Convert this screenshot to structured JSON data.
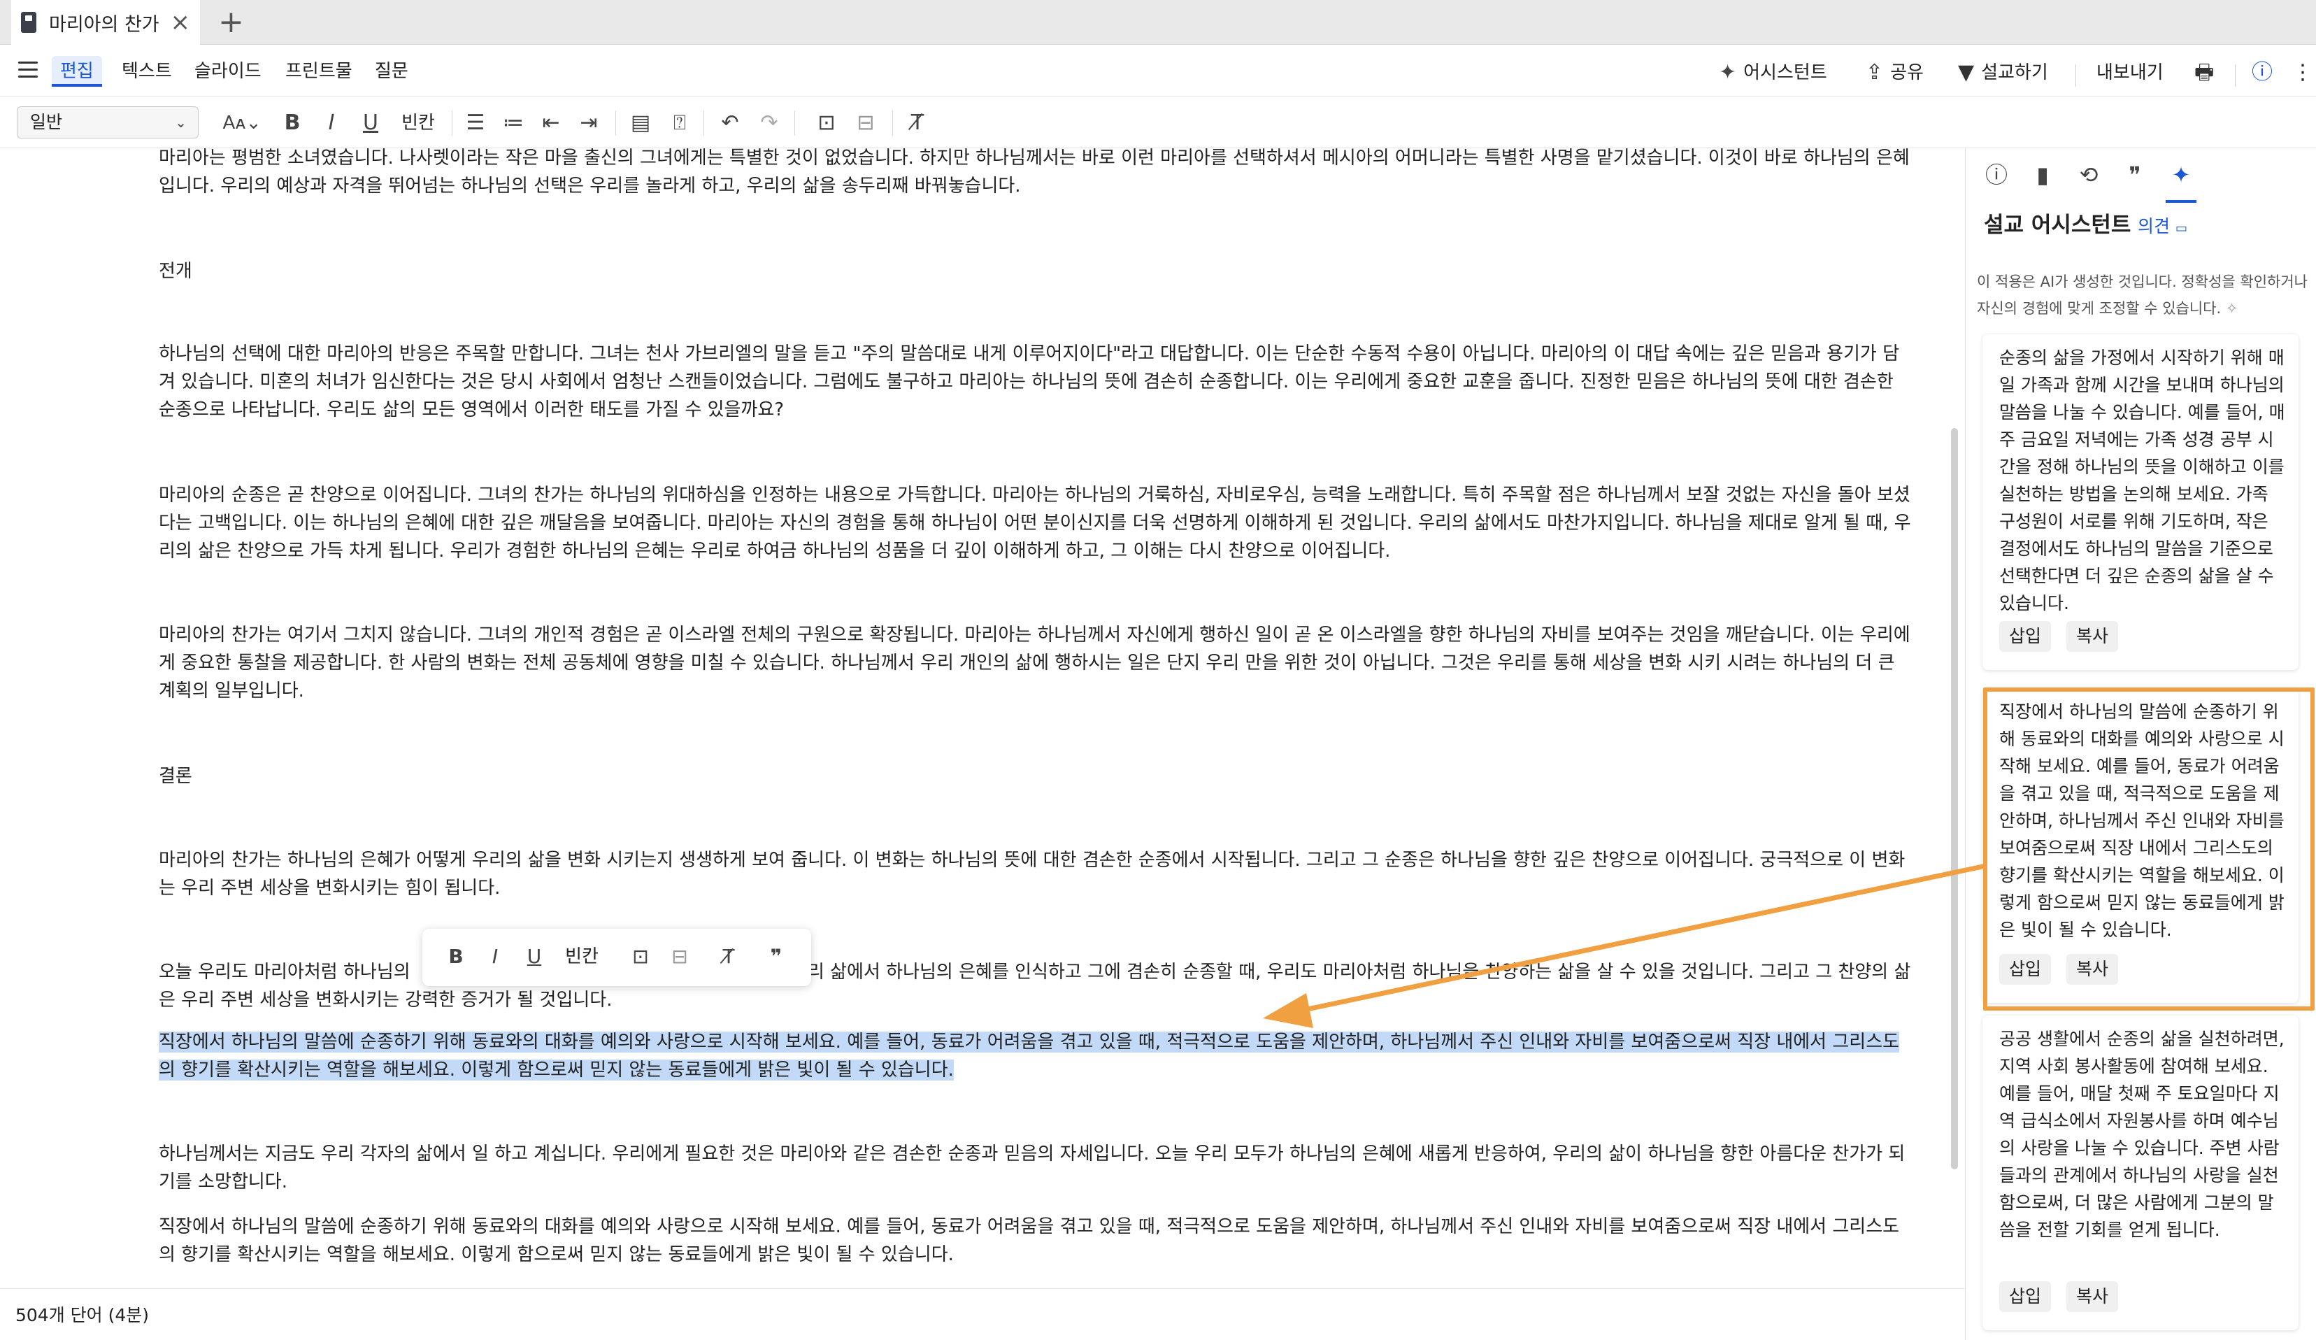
{
  "tab": {
    "title": "마리아의 찬가",
    "close": "×",
    "new": "+"
  },
  "menu": {
    "edit": "편집",
    "text": "텍스트",
    "slide": "슬라이드",
    "print": "프린트물",
    "question": "질문"
  },
  "actions": {
    "assistant": "어시스턴트",
    "share": "공유",
    "sermon": "설교하기",
    "export": "내보내기"
  },
  "toolbar": {
    "style": "일반",
    "bold": "B",
    "italic": "I",
    "underline": "U",
    "blank": "빈칸"
  },
  "document": {
    "p1": "마리아는 평범한 소녀였습니다. 나사렛이라는 작은 마을 출신의 그녀에게는 특별한 것이 없었습니다. 하지만 하나님께서는 바로 이런 마리아를 선택하셔서 메시아의 어머니라는 특별한 사명을 맡기셨습니다. 이것이 바로 하나님의 은혜입니다. 우리의 예상과 자격을 뛰어넘는 하나님의 선택은 우리를 놀라게 하고, 우리의 삶을 송두리째 바꿔놓습니다.",
    "h_development": "전개",
    "p2": "하나님의 선택에 대한 마리아의 반응은 주목할 만합니다. 그녀는 천사 가브리엘의 말을 듣고 \"주의 말씀대로 내게 이루어지이다\"라고 대답합니다. 이는 단순한 수동적 수용이 아닙니다. 마리아의 이 대답 속에는 깊은 믿음과 용기가 담겨 있습니다. 미혼의 처녀가 임신한다는 것은 당시 사회에서 엄청난 스캔들이었습니다. 그럼에도 불구하고 마리아는 하나님의 뜻에 겸손히 순종합니다. 이는 우리에게 중요한 교훈을 줍니다. 진정한 믿음은 하나님의 뜻에 대한 겸손한 순종으로 나타납니다. 우리도 삶의 모든 영역에서 이러한 태도를 가질 수 있을까요?",
    "p3": "마리아의 순종은 곧 찬양으로 이어집니다. 그녀의 찬가는 하나님의 위대하심을 인정하는 내용으로 가득합니다. 마리아는 하나님의 거룩하심, 자비로우심, 능력을 노래합니다. 특히 주목할 점은 하나님께서 보잘 것없는 자신을 돌아 보셨다는 고백입니다. 이는 하나님의 은혜에 대한 깊은 깨달음을 보여줍니다. 마리아는 자신의 경험을 통해 하나님이 어떤 분이신지를 더욱 선명하게 이해하게 된 것입니다. 우리의 삶에서도 마찬가지입니다. 하나님을 제대로 알게 될 때, 우리의 삶은 찬양으로 가득 차게 됩니다. 우리가 경험한 하나님의 은혜는 우리로 하여금 하나님의 성품을 더 깊이 이해하게 하고, 그 이해는 다시 찬양으로 이어집니다.",
    "p4": "마리아의 찬가는 여기서 그치지 않습니다. 그녀의 개인적 경험은 곧 이스라엘 전체의 구원으로 확장됩니다. 마리아는 하나님께서 자신에게 행하신 일이 곧 온 이스라엘을 향한 하나님의 자비를 보여주는 것임을 깨닫습니다. 이는 우리에게 중요한 통찰을 제공합니다. 한 사람의 변화는 전체 공동체에 영향을 미칠 수 있습니다. 하나님께서 우리 개인의 삶에 행하시는 일은 단지 우리 만을 위한 것이 아닙니다. 그것은 우리를 통해 세상을 변화 시키 시려는 하나님의 더 큰 계획의 일부입니다.",
    "h_conclusion": "결론",
    "p5": "마리아의 찬가는 하나님의 은혜가 어떻게 우리의 삶을 변화 시키는지 생생하게 보여 줍니다. 이 변화는 하나님의 뜻에 대한 겸손한 순종에서 시작됩니다. 그리고 그 순종은 하나님을 향한 깊은 찬양으로 이어집니다. 궁극적으로 이 변화는 우리 주변 세상을 변화시키는 힘이 됩니다.",
    "p6_start": "오늘 우리도 마리아처럼 하나님의 ",
    "p6_end": "리 삶에서 하나님의 은혜를 인식하고 그에 겸손히 순종할 때, 우리도 마리아처럼 하나님을 찬양하는 삶을 살 수 있을 것입니다. 그리고 그 찬양의 삶은 우리 주변 세상을 변화시키는 강력한 증거가 될 것입니다.",
    "p7_selected": "직장에서 하나님의 말씀에 순종하기 위해 동료와의 대화를 예의와 사랑으로 시작해 보세요. 예를 들어, 동료가 어려움을 겪고 있을 때, 적극적으로 도움을 제안하며, 하나님께서 주신 인내와 자비를 보여줌으로써 직장 내에서 그리스도의 향기를 확산시키는 역할을 해보세요. 이렇게 함으로써 믿지 않는 동료들에게 밝은 빛이 될 수 있습니다.",
    "p8": "하나님께서는 지금도 우리 각자의 삶에서 일 하고 계십니다. 우리에게 필요한 것은 마리아와 같은 겸손한 순종과 믿음의 자세입니다. 오늘 우리 모두가 하나님의 은혜에 새롭게 반응하여, 우리의 삶이 하나님을 향한 아름다운 찬가가 되기를 소망합니다.",
    "p9": "직장에서 하나님의 말씀에 순종하기 위해 동료와의 대화를 예의와 사랑으로 시작해 보세요. 예를 들어, 동료가 어려움을 겪고 있을 때, 적극적으로 도움을 제안하며, 하나님께서 주신 인내와 자비를 보여줌으로써 직장 내에서 그리스도의 향기를 확산시키는 역할을 해보세요. 이렇게 함으로써 믿지 않는 동료들에게 밝은 빛이 될 수 있습니다."
  },
  "status": {
    "word_count": "504개 단어 (4분)"
  },
  "panel": {
    "title": "설교 어시스턴트",
    "feedback": "의견",
    "notice": "이 적용은 AI가 생성한 것입니다. 정확성을 확인하거나 자신의 경험에 맞게 조정할 수 있습니다.",
    "cards": [
      {
        "text": "순종의 삶을 가정에서 시작하기 위해 매일 가족과 함께 시간을 보내며 하나님의 말씀을 나눌 수 있습니다. 예를 들어, 매주 금요일 저녁에는 가족 성경 공부 시간을 정해 하나님의 뜻을 이해하고 이를 실천하는 방법을 논의해 보세요. 가족 구성원이 서로를 위해 기도하며, 작은 결정에서도 하나님의 말씀을 기준으로 선택한다면 더 깊은 순종의 삶을 살 수 있습니다.",
        "insert": "삽입",
        "copy": "복사"
      },
      {
        "text": "직장에서 하나님의 말씀에 순종하기 위해 동료와의 대화를 예의와 사랑으로 시작해 보세요. 예를 들어, 동료가 어려움을 겪고 있을 때, 적극적으로 도움을 제안하며, 하나님께서 주신 인내와 자비를 보여줌으로써 직장 내에서 그리스도의 향기를 확산시키는 역할을 해보세요. 이렇게 함으로써 믿지 않는 동료들에게 밝은 빛이 될 수 있습니다.",
        "insert": "삽입",
        "copy": "복사"
      },
      {
        "text": "공공 생활에서 순종의 삶을 실천하려면, 지역 사회 봉사활동에 참여해 보세요. 예를 들어, 매달 첫째 주 토요일마다 지역 급식소에서 자원봉사를 하며 예수님의 사랑을 나눌 수 있습니다. 주변 사람들과의 관계에서 하나님의 사랑을 실천함으로써, 더 많은 사람에게 그분의 말씀을 전할 기회를 얻게 됩니다.",
        "insert": "삽입",
        "copy": "복사"
      }
    ]
  },
  "colors": {
    "accent": "#1a56d6",
    "selection": "#c3d9f8",
    "highlight_frame": "#f0a040"
  }
}
